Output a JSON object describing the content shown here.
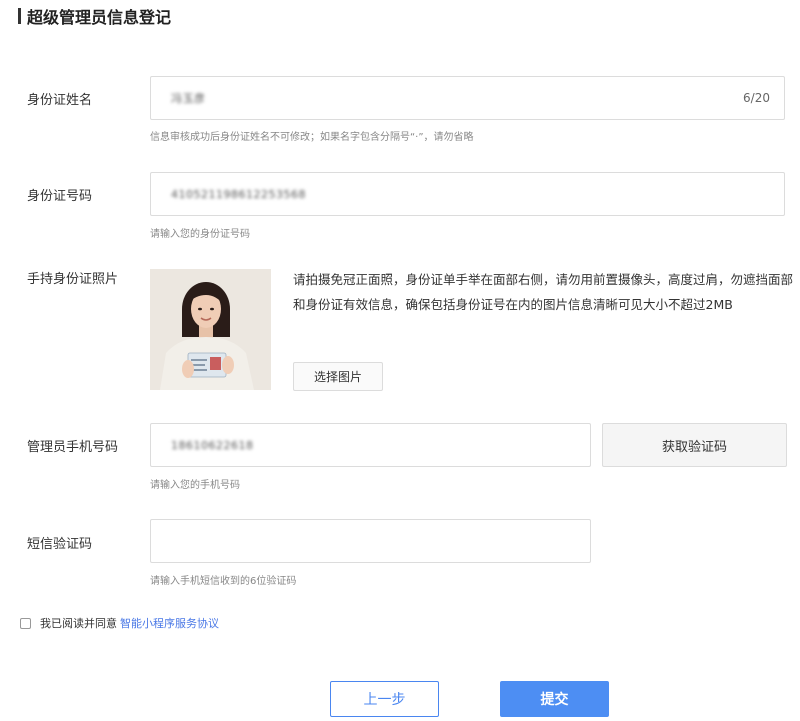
{
  "page": {
    "title": "超级管理员信息登记"
  },
  "name_field": {
    "label": "身份证姓名",
    "value": "冯玉彦",
    "counter": "6/20",
    "hint": "信息审核成功后身份证姓名不可修改；如果名字包含分隔号“·”，请勿省略"
  },
  "id_field": {
    "label": "身份证号码",
    "value": "410521198612253568",
    "hint": "请输入您的身份证号码"
  },
  "photo_field": {
    "label": "手持身份证照片",
    "description": "请拍摄免冠正面照，身份证单手举在面部右侧，请勿用前置摄像头，高度过肩，勿遮挡面部和身份证有效信息，确保包括身份证号在内的图片信息清晰可见大小不超过2MB",
    "choose_label": "选择图片"
  },
  "phone_field": {
    "label": "管理员手机号码",
    "value": "18610622618",
    "code_button": "获取验证码",
    "hint": "请输入您的手机号码"
  },
  "sms_field": {
    "label": "短信验证码",
    "hint": "请输入手机短信收到的6位验证码"
  },
  "agreement": {
    "text": "我已阅读并同意",
    "link": "智能小程序服务协议"
  },
  "footer": {
    "prev_label": "上一步",
    "submit_label": "提交"
  },
  "colors": {
    "accent": "#4d8ef3",
    "link": "#4a78e6"
  }
}
